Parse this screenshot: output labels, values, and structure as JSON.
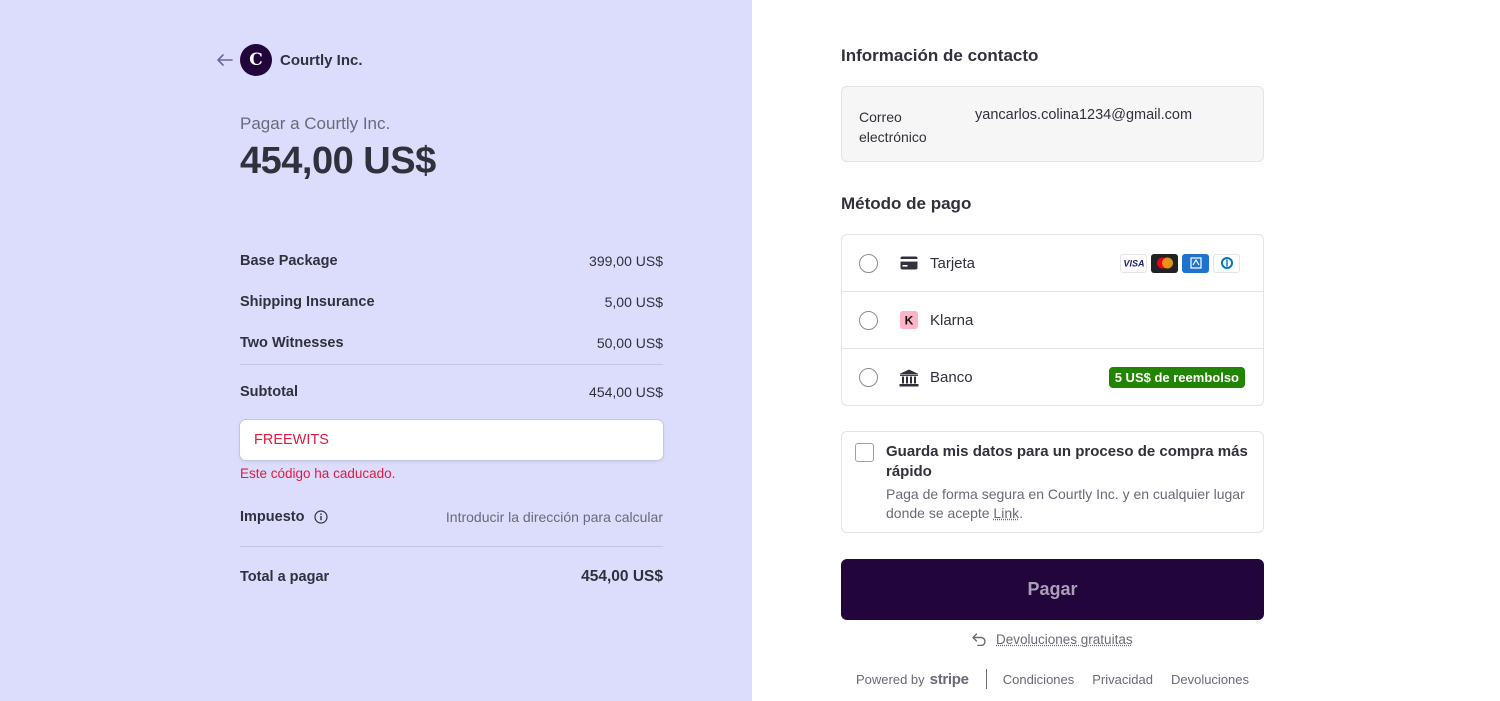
{
  "merchant": {
    "name": "Courtly Inc.",
    "logo_letter": "C",
    "pay_to": "Pagar a Courtly Inc.",
    "amount": "454,00 US$"
  },
  "summary": {
    "items": [
      {
        "label": "Base Package",
        "value": "399,00 US$"
      },
      {
        "label": "Shipping Insurance",
        "value": "5,00 US$"
      },
      {
        "label": "Two Witnesses",
        "value": "50,00 US$"
      }
    ],
    "subtotal_label": "Subtotal",
    "subtotal_value": "454,00 US$",
    "promo_code": "FREEWITS",
    "promo_error": "Este código ha caducado.",
    "tax_label": "Impuesto",
    "tax_value": "Introducir la dirección para calcular",
    "total_label": "Total a pagar",
    "total_value": "454,00 US$"
  },
  "contact": {
    "title": "Información de contacto",
    "email_label": "Correo electrónico",
    "email_value": "yancarlos.colina1234@gmail.com"
  },
  "payment": {
    "title": "Método de pago",
    "methods": [
      {
        "label": "Tarjeta",
        "icon": "credit-card-icon",
        "brands": [
          "VISA",
          "Mastercard",
          "American Express",
          "Diners Club"
        ]
      },
      {
        "label": "Klarna",
        "icon": "klarna-icon",
        "icon_letter": "K"
      },
      {
        "label": "Banco",
        "icon": "bank-icon",
        "badge": "5 US$ de reembolso"
      }
    ]
  },
  "save_info": {
    "title": "Guarda mis datos para un proceso de compra más rápido",
    "desc_prefix": "Paga de forma segura en Courtly Inc. y en cualquier lugar donde se acepte ",
    "desc_link": "Link",
    "desc_suffix": "."
  },
  "pay_button": "Pagar",
  "returns_link": "Devoluciones gratuitas",
  "footer": {
    "powered_by": "Powered by",
    "stripe": "stripe",
    "links": [
      "Condiciones",
      "Privacidad",
      "Devoluciones"
    ]
  },
  "colors": {
    "left_bg": "#dcdcfc",
    "brand": "#22063b",
    "error": "#df1b41",
    "cashback": "#228403"
  }
}
